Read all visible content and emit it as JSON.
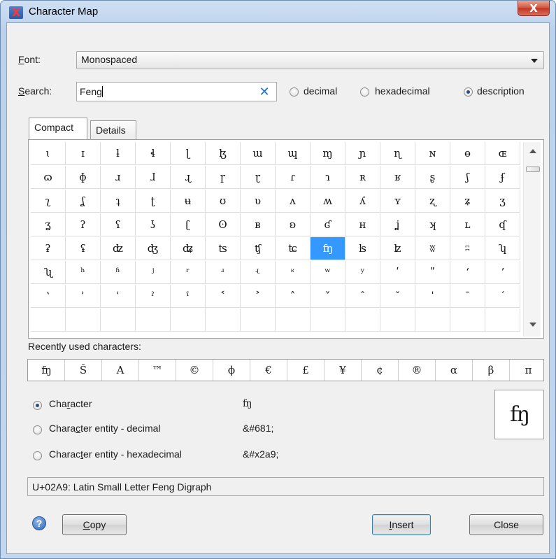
{
  "window": {
    "title": "Character Map",
    "close_glyph": "X"
  },
  "font_label": "Font:",
  "font_value": "Monospaced",
  "search_label": "Search:",
  "search_value": "Feng",
  "clear_glyph": "✕",
  "search_modes": [
    "decimal",
    "hexadecimal",
    "description"
  ],
  "selected_mode": "description",
  "tabs": [
    "Compact",
    "Details"
  ],
  "active_tab": "Compact",
  "grid": [
    [
      "ɩ",
      "ɪ",
      "ƚ",
      "ɬ",
      "ɭ",
      "ɮ",
      "ɯ",
      "ɰ",
      "ɱ",
      "ɲ",
      "ɳ",
      "ɴ",
      "ɵ",
      "ɶ"
    ],
    [
      "ɷ",
      "ɸ",
      "ɹ",
      "ɺ",
      "ɻ",
      "ɼ",
      "ɽ",
      "ɾ",
      "ɿ",
      "ʀ",
      "ʁ",
      "ʂ",
      "ʃ",
      "ʄ"
    ],
    [
      "ʅ",
      "ʆ",
      "ʇ",
      "ʈ",
      "ʉ",
      "ʊ",
      "ʋ",
      "ʌ",
      "ʍ",
      "ʎ",
      "ʏ",
      "ʐ",
      "ʑ",
      "ʒ"
    ],
    [
      "ʓ",
      "ʔ",
      "ʕ",
      "ʖ",
      "ʗ",
      "ʘ",
      "ʙ",
      "ʚ",
      "ʛ",
      "ʜ",
      "ʝ",
      "ʞ",
      "ʟ",
      "ʠ"
    ],
    [
      "ʡ",
      "ʢ",
      "ʣ",
      "ʤ",
      "ʥ",
      "ʦ",
      "ʧ",
      "ʨ",
      "ʩ",
      "ʪ",
      "ʫ",
      "ʬ",
      "ʭ",
      "ʮ"
    ],
    [
      "ʯ",
      "ʰ",
      "ʱ",
      "ʲ",
      "ʳ",
      "ʴ",
      "ʵ",
      "ʶ",
      "ʷ",
      "ʸ",
      "ʹ",
      "ʺ",
      "ʻ",
      "ʼ"
    ],
    [
      "ʽ",
      "ʾ",
      "ʿ",
      "ˀ",
      "ˁ",
      "˂",
      "˃",
      "˄",
      "˅",
      "ˆ",
      "ˇ",
      "ˈ",
      "ˉ",
      "ˊ"
    ],
    [
      "",
      "",
      "",
      "",
      "",
      "",
      "",
      "",
      "",
      "",
      "",
      "",
      "",
      ""
    ]
  ],
  "selected_char": "ʩ",
  "recent_label": "Recently used characters:",
  "recent": [
    "ʩ",
    "Š",
    "A",
    "™",
    "©",
    "ϕ",
    "€",
    "£",
    "¥",
    "¢",
    "®",
    "α",
    "β",
    "π"
  ],
  "insert_options": [
    {
      "label": "Character",
      "value": "ʩ"
    },
    {
      "label": "Character entity - decimal",
      "value": "&#681;"
    },
    {
      "label": "Character entity - hexadecimal",
      "value": "&#x2a9;"
    }
  ],
  "selected_insert_option": "Character",
  "preview_char": "ʩ",
  "status_text": "U+02A9: Latin Small Letter Feng Digraph",
  "help_glyph": "?",
  "buttons": {
    "copy": "Copy",
    "insert": "Insert",
    "close": "Close"
  }
}
